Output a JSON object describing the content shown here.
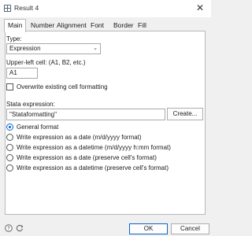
{
  "window": {
    "title": "Result 4"
  },
  "tabs": [
    {
      "label": "Main"
    },
    {
      "label": "Number"
    },
    {
      "label": "Alignment"
    },
    {
      "label": "Font"
    },
    {
      "label": "Border"
    },
    {
      "label": "Fill"
    }
  ],
  "main": {
    "type_label": "Type:",
    "type_value": "Expression",
    "cell_label": "Upper-left cell: (A1, B2, etc.)",
    "cell_value": "A1",
    "overwrite_label": "Overwrite existing cell formatting",
    "stata_label": "Stata expression:",
    "stata_value": "\"Stataformatting\"",
    "create_label": "Create...",
    "radio_options": [
      "General format",
      "Write expression as a date (m/d/yyyy format)",
      "Write expression as a datetime (m/d/yyyy h:mm format)",
      "Write expression as a date (preserve cell's format)",
      "Write expression as a datetime (preserve cell's format)"
    ],
    "selected_option": 0
  },
  "footer": {
    "ok_label": "OK",
    "cancel_label": "Cancel"
  },
  "colors": {
    "accent": "#0a64c9",
    "panel": "#ffffff",
    "background": "#f0f0f0"
  }
}
